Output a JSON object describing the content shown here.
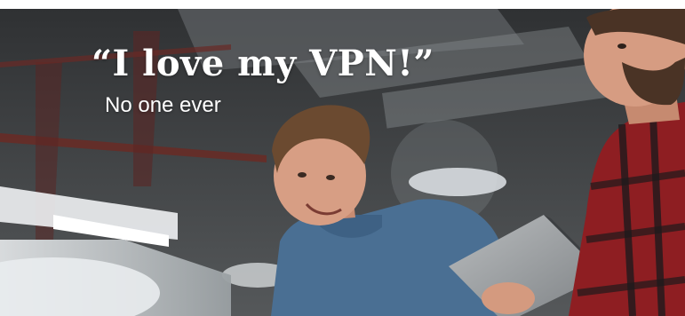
{
  "banner": {
    "quote": "“I love my VPN!”",
    "attribution": "No one ever"
  },
  "colors": {
    "text": "#ffffff",
    "ceiling": "#3b3e40",
    "shirt_blue": "#4a6f93",
    "plaid_red": "#8e1e22"
  }
}
